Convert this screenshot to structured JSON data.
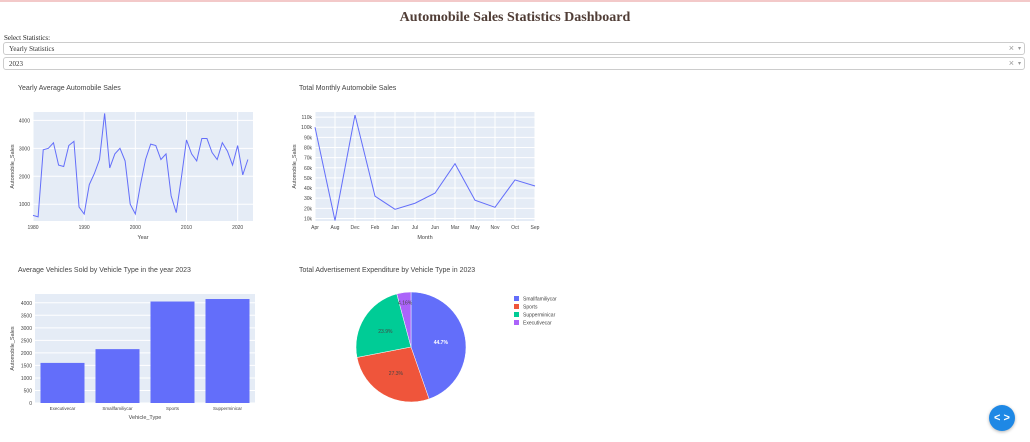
{
  "page": {
    "title": "Automobile Sales Statistics Dashboard"
  },
  "controls": {
    "select_label": "Select Statistics:",
    "statistics_dropdown": {
      "value": "Yearly Statistics",
      "clear": "×",
      "arrow": "▾"
    },
    "year_dropdown": {
      "value": "2023",
      "clear": "×",
      "arrow": "▾"
    }
  },
  "fab": {
    "label": "< >",
    "icon": "code-toggle-icon"
  },
  "colors": {
    "plot_bg": "#e5ecf6",
    "line": "#636efa",
    "title": "#503d36"
  },
  "chart_data": [
    {
      "type": "line",
      "title": "Yearly Average Automobile Sales",
      "xlabel": "Year",
      "ylabel": "Automobile_Sales",
      "xlim": [
        1980,
        2023
      ],
      "ylim": [
        400,
        4300
      ],
      "xticks": [
        1980,
        1990,
        2000,
        2010,
        2020
      ],
      "yticks": [
        1000,
        2000,
        3000,
        4000
      ],
      "ytick_labels": [
        "1000",
        "2000",
        "3000",
        "4000"
      ],
      "x": [
        1980,
        1981,
        1982,
        1983,
        1984,
        1985,
        1986,
        1987,
        1988,
        1989,
        1990,
        1991,
        1992,
        1993,
        1994,
        1995,
        1996,
        1997,
        1998,
        1999,
        2000,
        2001,
        2002,
        2003,
        2004,
        2005,
        2006,
        2007,
        2008,
        2009,
        2010,
        2011,
        2012,
        2013,
        2014,
        2015,
        2016,
        2017,
        2018,
        2019,
        2020,
        2021,
        2022,
        2023
      ],
      "series": [
        {
          "values": [
            600,
            550,
            2950,
            3000,
            3200,
            2400,
            2350,
            3100,
            3250,
            900,
            650,
            1700,
            2100,
            2600,
            4250,
            2300,
            2800,
            3000,
            2550,
            1000,
            650,
            1700,
            2600,
            3150,
            3100,
            2600,
            2800,
            1300,
            700,
            1950,
            3300,
            2800,
            2550,
            3350,
            3350,
            2850,
            2600,
            3200,
            2900,
            2400,
            3100,
            2050,
            2600
          ]
        }
      ]
    },
    {
      "type": "line",
      "title": "Total Monthly Automobile Sales",
      "xlabel": "Month",
      "ylabel": "Automobile_Sales",
      "categories": [
        "Apr",
        "Aug",
        "Dec",
        "Feb",
        "Jan",
        "Jul",
        "Jun",
        "Mar",
        "May",
        "Nov",
        "Oct",
        "Sep"
      ],
      "ylim": [
        7500,
        115000
      ],
      "yticks": [
        10000,
        20000,
        30000,
        40000,
        50000,
        60000,
        70000,
        80000,
        90000,
        100000,
        110000
      ],
      "ytick_labels": [
        "10k",
        "20k",
        "30k",
        "40k",
        "50k",
        "60k",
        "70k",
        "80k",
        "90k",
        "100k",
        "110k"
      ],
      "series": [
        {
          "values": [
            100000,
            8000,
            112000,
            32000,
            19000,
            25000,
            35000,
            64000,
            28000,
            21000,
            48000,
            42000
          ]
        }
      ]
    },
    {
      "type": "bar",
      "title": "Average Vehicles Sold by Vehicle Type in the year 2023",
      "xlabel": "Vehicle_Type",
      "ylabel": "Automobile_Sales",
      "categories": [
        "Executivecar",
        "Smallfamiliycar",
        "Sports",
        "Supperminicar"
      ],
      "values": [
        1600,
        2150,
        4050,
        4150
      ],
      "ylim": [
        0,
        4350
      ],
      "yticks": [
        0,
        500,
        1000,
        1500,
        2000,
        2500,
        3000,
        3500,
        4000
      ],
      "ytick_labels": [
        "0",
        "500",
        "1000",
        "1500",
        "2000",
        "2500",
        "3000",
        "3500",
        "4000"
      ]
    },
    {
      "type": "pie",
      "title": "Total Advertisement Expenditure by Vehicle Type in 2023",
      "labels": [
        "Smallfamiliycar",
        "Sports",
        "Supperminicar",
        "Executivecar"
      ],
      "values": [
        44.7,
        27.3,
        23.9,
        4.16
      ],
      "percent_labels": [
        "44.7%",
        "27.3%",
        "23.9%",
        "4.16%"
      ],
      "colors": [
        "#636efa",
        "#ef553b",
        "#00cc96",
        "#ab63fa"
      ],
      "legend_position": "right"
    }
  ]
}
